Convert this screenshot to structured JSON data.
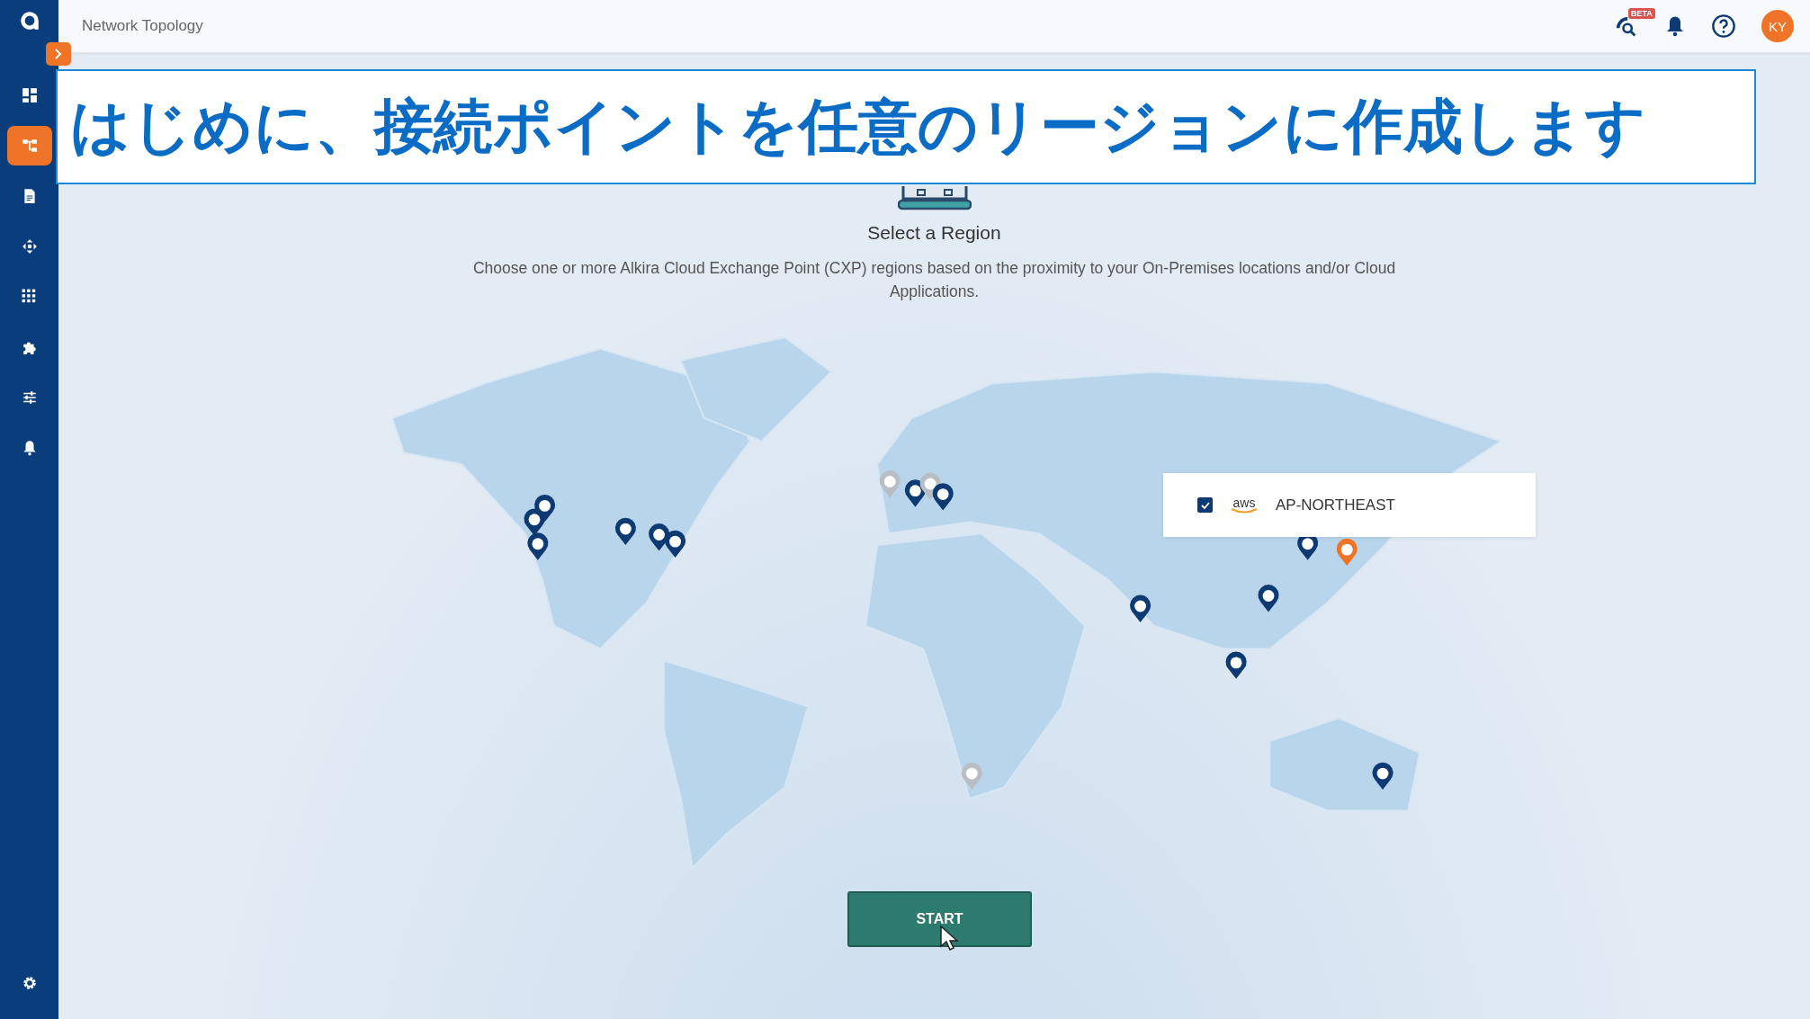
{
  "header": {
    "title": "Network Topology",
    "beta_badge": "BETA",
    "avatar": "KY"
  },
  "sidebar": {
    "items": [
      {
        "kind": "dashboard",
        "selected": false
      },
      {
        "kind": "topology",
        "selected": true
      },
      {
        "kind": "document",
        "selected": false
      },
      {
        "kind": "network",
        "selected": false
      },
      {
        "kind": "apps",
        "selected": false
      },
      {
        "kind": "puzzle",
        "selected": false
      },
      {
        "kind": "sliders",
        "selected": false
      },
      {
        "kind": "bell",
        "selected": false
      }
    ]
  },
  "caption": "はじめに、接続ポイントを任意のリージョンに作成します",
  "region_selector": {
    "title": "Select a Region",
    "description": "Choose one or more Alkira Cloud Exchange Point (CXP) regions based on the proximity to your On-Premises locations and/or Cloud Applications.",
    "tooltip": {
      "checked": true,
      "provider": "aws",
      "region": "AP-NORTHEAST"
    },
    "start_button": "START"
  }
}
